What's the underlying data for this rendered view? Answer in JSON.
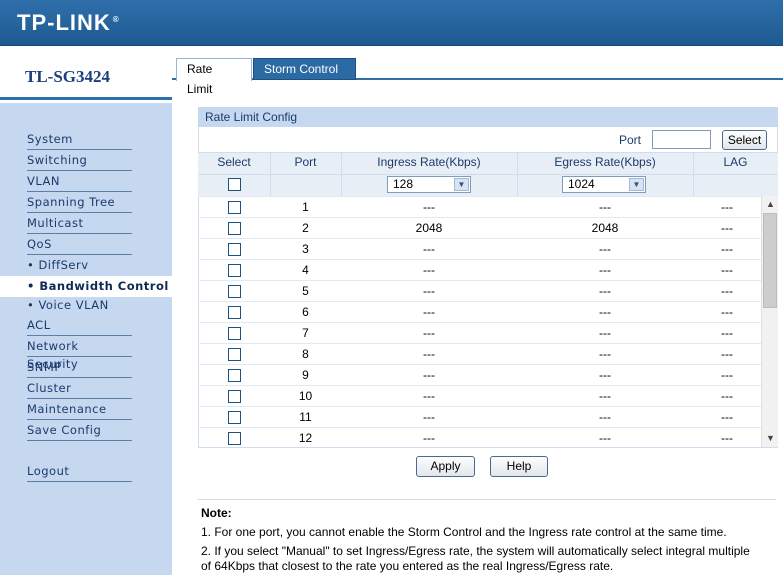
{
  "brand": {
    "logo": "TP-LINK",
    "registered": "®",
    "model": "TL-SG3424"
  },
  "tabs": [
    {
      "label": "Rate Limit",
      "active": true
    },
    {
      "label": "Storm Control",
      "active": false
    }
  ],
  "sidebar": {
    "items": [
      {
        "label": "System"
      },
      {
        "label": "Switching"
      },
      {
        "label": "VLAN"
      },
      {
        "label": "Spanning Tree"
      },
      {
        "label": "Multicast"
      },
      {
        "label": "QoS"
      },
      {
        "label": "• DiffServ"
      },
      {
        "label": "• Bandwidth Control",
        "active": true
      },
      {
        "label": "• Voice VLAN"
      },
      {
        "label": "ACL"
      },
      {
        "label": "Network Security"
      },
      {
        "label": "SNMP"
      },
      {
        "label": "Cluster"
      },
      {
        "label": "Maintenance"
      },
      {
        "label": "Save Config"
      },
      {
        "label": "Logout"
      }
    ]
  },
  "panel": {
    "title": "Rate Limit Config",
    "port_label": "Port",
    "port_value": "",
    "select_button": "Select",
    "columns": [
      "Select",
      "Port",
      "Ingress Rate(Kbps)",
      "Egress Rate(Kbps)",
      "LAG"
    ],
    "ingress_select": "128",
    "egress_select": "1024",
    "rows": [
      {
        "port": "1",
        "ingress": "---",
        "egress": "---",
        "lag": "---"
      },
      {
        "port": "2",
        "ingress": "2048",
        "egress": "2048",
        "lag": "---"
      },
      {
        "port": "3",
        "ingress": "---",
        "egress": "---",
        "lag": "---"
      },
      {
        "port": "4",
        "ingress": "---",
        "egress": "---",
        "lag": "---"
      },
      {
        "port": "5",
        "ingress": "---",
        "egress": "---",
        "lag": "---"
      },
      {
        "port": "6",
        "ingress": "---",
        "egress": "---",
        "lag": "---"
      },
      {
        "port": "7",
        "ingress": "---",
        "egress": "---",
        "lag": "---"
      },
      {
        "port": "8",
        "ingress": "---",
        "egress": "---",
        "lag": "---"
      },
      {
        "port": "9",
        "ingress": "---",
        "egress": "---",
        "lag": "---"
      },
      {
        "port": "10",
        "ingress": "---",
        "egress": "---",
        "lag": "---"
      },
      {
        "port": "11",
        "ingress": "---",
        "egress": "---",
        "lag": "---"
      },
      {
        "port": "12",
        "ingress": "---",
        "egress": "---",
        "lag": "---"
      }
    ]
  },
  "actions": {
    "apply": "Apply",
    "help": "Help"
  },
  "note": {
    "title": "Note:",
    "line1": "1. For one port, you cannot enable the Storm Control and the Ingress rate control at the same time.",
    "line2a": "2. If you select \"Manual\" to set Ingress/Egress rate, the system will automatically select integral multiple",
    "line2b": "of 64Kbps that closest to the rate you entered as the real Ingress/Egress rate."
  },
  "icons": {
    "dropdown": "chevron-down-icon",
    "scroll_up": "scroll-up-icon",
    "scroll_down": "scroll-down-icon"
  },
  "colors": {
    "header": "#2f6fa9",
    "sidebar": "#c5d8f0",
    "tab_inactive": "#2c6aa3"
  }
}
